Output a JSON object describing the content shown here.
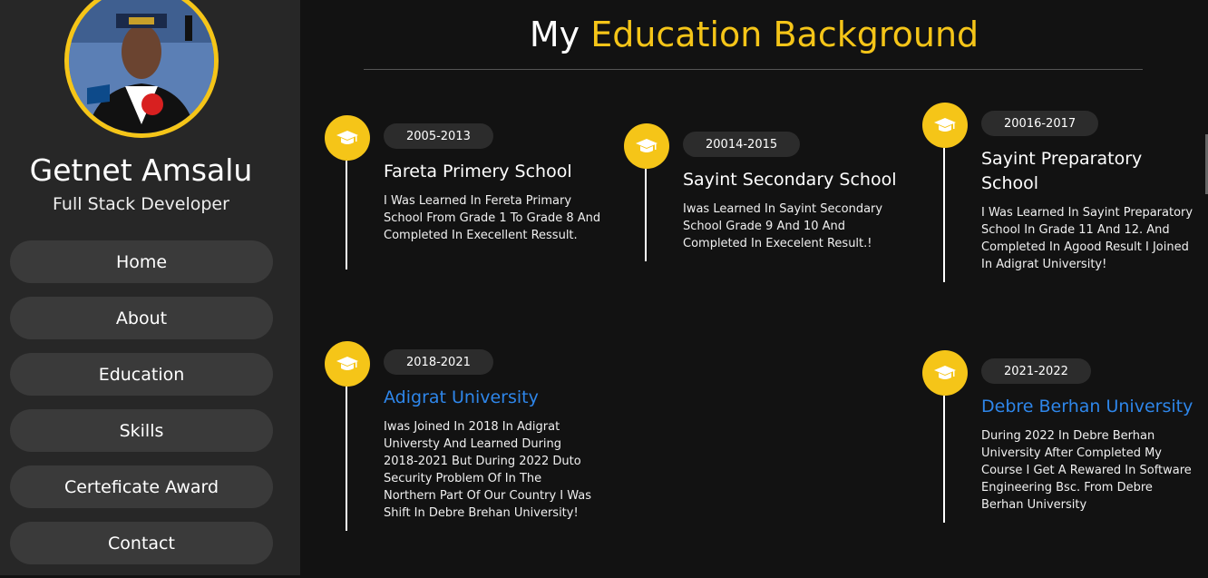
{
  "profile": {
    "name": "Getnet Amsalu",
    "role": "Full Stack Developer"
  },
  "nav": [
    {
      "label": "Home"
    },
    {
      "label": "About"
    },
    {
      "label": "Education"
    },
    {
      "label": "Skills"
    },
    {
      "label": "Certeficate Award"
    },
    {
      "label": "Contact"
    }
  ],
  "page": {
    "title_white": "My",
    "title_accent": "Education Background"
  },
  "colors": {
    "accent": "#f5c518",
    "link_blue": "#2e86ea",
    "background": "#121212",
    "sidebar": "#272727"
  },
  "education": [
    {
      "years": "2005-2013",
      "school": "Fareta Primery School",
      "description": "I Was Learned In Fereta Primary School From Grade 1 To Grade 8 And Completed In Execellent Ressult.",
      "icon": "graduation-cap-icon"
    },
    {
      "years": "20014-2015",
      "school": "Sayint Secondary School",
      "description": "Iwas Learned In Sayint Secondary School Grade 9 And 10 And Completed In Execelent Result.!",
      "icon": "graduation-cap-icon"
    },
    {
      "years": "20016-2017",
      "school": "Sayint Preparatory School",
      "description": "I Was Learned In Sayint Preparatory School In Grade 11 And 12. And Completed In Agood Result I Joined In Adigrat University!",
      "icon": "graduation-cap-icon"
    },
    {
      "years": "2018-2021",
      "school": "Adigrat University",
      "description": "Iwas Joined In 2018 In Adigrat Universty And Learned During 2018-2021 But During 2022 Duto Security Problem Of In The Northern Part Of Our Country I Was Shift In Debre Brehan University!",
      "icon": "graduation-cap-icon"
    },
    {
      "years": "2021-2022",
      "school": "Debre Berhan University",
      "description": "During 2022 In Debre Berhan University After Completed My Course I Get A Rewared In Software Engineering Bsc. From Debre Berhan University",
      "icon": "graduation-cap-icon"
    }
  ]
}
